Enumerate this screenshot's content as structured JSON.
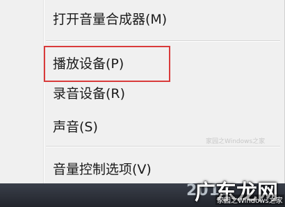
{
  "menu": {
    "items": [
      {
        "label": "打开音量合成器(M)"
      },
      {
        "label": "播放设备(P)"
      },
      {
        "label": "录音设备(R)"
      },
      {
        "label": "声音(S)"
      },
      {
        "label": "音量控制选项(V)"
      }
    ]
  },
  "taskbar": {
    "clock_partial": "2017"
  },
  "watermarks": {
    "site_mid": "家园之Windows之家",
    "logo": "广东龙网",
    "logo_sub": "家园之Windows之家"
  }
}
